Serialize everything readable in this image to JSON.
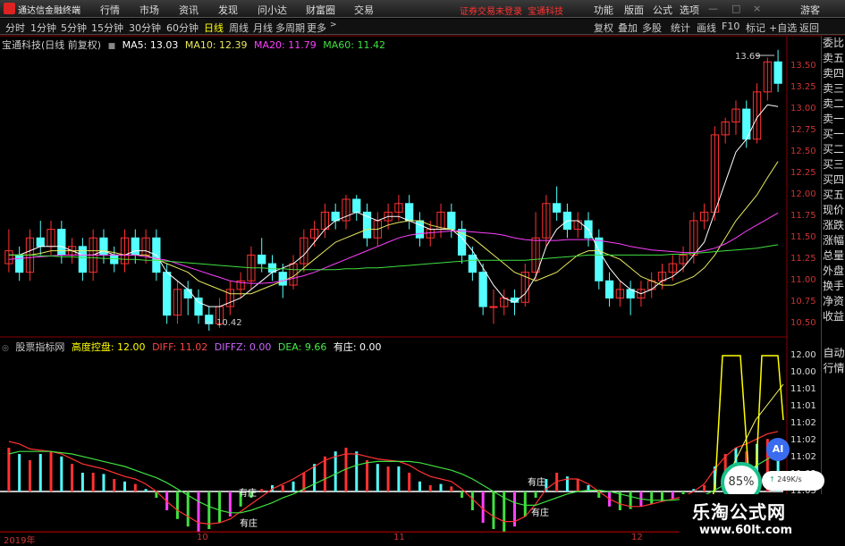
{
  "menubar": {
    "app_title": "通达信金融终端",
    "menus": [
      "行情",
      "市场",
      "资讯",
      "发现",
      "问小达",
      "财富圈",
      "交易"
    ],
    "notice": "证券交易未登录",
    "stock_name": "宝通科技",
    "right_menus": [
      "功能",
      "版面",
      "公式",
      "选项"
    ],
    "login": "游客"
  },
  "tabbar": {
    "tabs": [
      "分时",
      "1分钟",
      "5分钟",
      "15分钟",
      "30分钟",
      "60分钟",
      "日线",
      "周线",
      "月线",
      "多周期",
      "更多"
    ],
    "active_tab": "日线",
    "right_buttons": [
      "复权",
      "叠加",
      "多股",
      "统计",
      "画线",
      "F10",
      "标记",
      "+自选",
      "返回"
    ]
  },
  "kline_info": {
    "title": "宝通科技(日线 前复权)",
    "ma5": "MA5: 13.03",
    "ma10": "MA10: 12.39",
    "ma20": "MA20: 11.79",
    "ma60": "MA60: 11.42"
  },
  "sub_info": {
    "title": "股票指标网",
    "gkkp": "高度控盘: 12.00",
    "diff": "DIFF: 11.02",
    "diffz": "DIFFZ: 0.00",
    "dea": "DEA: 9.66",
    "youzhuang": "有庄: 0.00"
  },
  "price_axis": [
    "13.50",
    "13.25",
    "13.00",
    "12.75",
    "12.50",
    "12.25",
    "12.00",
    "11.75",
    "11.50",
    "11.25",
    "11.00",
    "10.75",
    "10.50"
  ],
  "sub_axis": [
    "12.00",
    "10.00",
    "11:01",
    "11:01",
    "11:02",
    "11:02",
    "11:02",
    "11:02",
    "11:03"
  ],
  "dates": [
    "2019年",
    "10",
    "11",
    "12"
  ],
  "annotations": {
    "high": "13.69",
    "low": "10.42",
    "zhuang_labels": [
      "有庄",
      "有庄",
      "有庄",
      "有庄"
    ]
  },
  "right_panel": {
    "items": [
      "委比",
      "卖五",
      "卖四",
      "卖三",
      "卖二",
      "卖一",
      "买一",
      "买二",
      "买三",
      "买四",
      "买五",
      "现价",
      "涨跌",
      "涨幅",
      "总量",
      "外盘",
      "换手",
      "净资",
      "收益"
    ],
    "items2": [
      "自动",
      "行情"
    ]
  },
  "widgets": {
    "ai": "AI",
    "speed": "85%",
    "net": "249K/s"
  },
  "watermark": {
    "line1": "乐淘公式网",
    "line2": "www.60lt.com"
  },
  "colors": {
    "up": "#ff3232",
    "down": "#54ffff",
    "ma5": "#ffffff",
    "ma10": "#e8e860",
    "ma20": "#ff40ff",
    "ma60": "#40e040",
    "accent": "#ffff00"
  },
  "chart_data": {
    "type": "candlestick",
    "ylim": [
      10.4,
      13.7
    ],
    "candles": [
      [
        11.2,
        11.35,
        11.1,
        11.6
      ],
      [
        11.3,
        11.1,
        11.0,
        11.4
      ],
      [
        11.1,
        11.5,
        11.0,
        11.6
      ],
      [
        11.5,
        11.4,
        11.3,
        11.7
      ],
      [
        11.4,
        11.6,
        11.3,
        11.7
      ],
      [
        11.6,
        11.3,
        11.2,
        11.7
      ],
      [
        11.3,
        11.4,
        11.2,
        11.5
      ],
      [
        11.4,
        11.1,
        11.0,
        11.5
      ],
      [
        11.1,
        11.5,
        11.0,
        11.6
      ],
      [
        11.5,
        11.3,
        11.2,
        11.6
      ],
      [
        11.3,
        11.2,
        11.1,
        11.4
      ],
      [
        11.2,
        11.5,
        11.1,
        11.6
      ],
      [
        11.5,
        11.3,
        11.2,
        11.6
      ],
      [
        11.3,
        11.5,
        11.2,
        11.6
      ],
      [
        11.5,
        11.1,
        11.0,
        11.6
      ],
      [
        11.1,
        10.6,
        10.5,
        11.2
      ],
      [
        10.6,
        10.9,
        10.5,
        11.0
      ],
      [
        10.9,
        10.8,
        10.6,
        11.0
      ],
      [
        10.8,
        10.6,
        10.5,
        10.9
      ],
      [
        10.6,
        10.5,
        10.42,
        10.7
      ],
      [
        10.5,
        10.7,
        10.45,
        10.8
      ],
      [
        10.7,
        10.9,
        10.6,
        11.0
      ],
      [
        10.9,
        11.0,
        10.8,
        11.1
      ],
      [
        11.0,
        11.3,
        10.9,
        11.4
      ],
      [
        11.3,
        11.2,
        11.1,
        11.5
      ],
      [
        11.2,
        11.1,
        11.0,
        11.3
      ],
      [
        11.1,
        10.95,
        10.8,
        11.2
      ],
      [
        10.95,
        11.2,
        10.9,
        11.3
      ],
      [
        11.2,
        11.5,
        11.1,
        11.6
      ],
      [
        11.5,
        11.6,
        11.4,
        11.7
      ],
      [
        11.6,
        11.8,
        11.5,
        11.9
      ],
      [
        11.8,
        11.7,
        11.6,
        11.9
      ],
      [
        11.7,
        11.95,
        11.6,
        12.0
      ],
      [
        11.95,
        11.8,
        11.7,
        12.0
      ],
      [
        11.8,
        11.5,
        11.4,
        11.9
      ],
      [
        11.5,
        11.7,
        11.4,
        11.8
      ],
      [
        11.7,
        11.8,
        11.6,
        11.9
      ],
      [
        11.8,
        11.9,
        11.7,
        12.0
      ],
      [
        11.9,
        11.7,
        11.6,
        12.0
      ],
      [
        11.7,
        11.5,
        11.4,
        11.8
      ],
      [
        11.5,
        11.6,
        11.4,
        11.7
      ],
      [
        11.6,
        11.8,
        11.5,
        11.9
      ],
      [
        11.8,
        11.6,
        11.5,
        11.9
      ],
      [
        11.6,
        11.3,
        11.2,
        11.7
      ],
      [
        11.3,
        11.1,
        11.0,
        11.4
      ],
      [
        11.1,
        10.7,
        10.6,
        11.2
      ],
      [
        10.7,
        10.7,
        10.5,
        10.9
      ],
      [
        10.7,
        10.8,
        10.6,
        10.9
      ],
      [
        10.8,
        10.75,
        10.6,
        10.9
      ],
      [
        10.75,
        11.1,
        10.7,
        11.2
      ],
      [
        11.1,
        11.5,
        11.0,
        11.8
      ],
      [
        11.5,
        11.9,
        11.4,
        12.0
      ],
      [
        11.9,
        11.8,
        11.7,
        12.1
      ],
      [
        11.8,
        11.6,
        11.5,
        11.9
      ],
      [
        11.6,
        11.7,
        11.5,
        11.8
      ],
      [
        11.7,
        11.5,
        11.4,
        11.8
      ],
      [
        11.5,
        11.0,
        10.9,
        11.6
      ],
      [
        11.0,
        10.8,
        10.7,
        11.1
      ],
      [
        10.8,
        10.9,
        10.7,
        11.0
      ],
      [
        10.9,
        10.8,
        10.6,
        11.0
      ],
      [
        10.8,
        10.9,
        10.7,
        11.0
      ],
      [
        10.9,
        11.0,
        10.8,
        11.1
      ],
      [
        11.0,
        11.1,
        10.9,
        11.2
      ],
      [
        11.1,
        11.2,
        11.0,
        11.3
      ],
      [
        11.2,
        11.3,
        11.1,
        11.4
      ],
      [
        11.3,
        11.7,
        11.2,
        11.8
      ],
      [
        11.7,
        11.8,
        11.6,
        11.9
      ],
      [
        11.8,
        12.7,
        11.7,
        12.8
      ],
      [
        12.7,
        12.85,
        12.6,
        12.9
      ],
      [
        12.85,
        13.0,
        12.7,
        13.1
      ],
      [
        13.0,
        12.65,
        12.55,
        13.1
      ],
      [
        12.65,
        13.2,
        12.6,
        13.3
      ],
      [
        13.2,
        13.55,
        13.1,
        13.6
      ],
      [
        13.55,
        13.3,
        13.2,
        13.69
      ]
    ],
    "ma5": [
      11.3,
      11.3,
      11.35,
      11.4,
      11.4,
      11.4,
      11.35,
      11.3,
      11.3,
      11.35,
      11.3,
      11.3,
      11.35,
      11.35,
      11.3,
      11.1,
      11.0,
      10.9,
      10.75,
      10.7,
      10.7,
      10.75,
      10.8,
      10.9,
      11.0,
      11.1,
      11.15,
      11.2,
      11.3,
      11.45,
      11.6,
      11.7,
      11.75,
      11.8,
      11.75,
      11.7,
      11.75,
      11.75,
      11.7,
      11.65,
      11.6,
      11.6,
      11.6,
      11.5,
      11.35,
      11.15,
      10.95,
      10.8,
      10.75,
      10.85,
      11.05,
      11.4,
      11.6,
      11.7,
      11.7,
      11.6,
      11.35,
      11.15,
      11.0,
      10.9,
      10.85,
      10.9,
      11.0,
      11.05,
      11.15,
      11.3,
      11.45,
      11.8,
      12.15,
      12.5,
      12.65,
      12.9,
      13.05,
      13.03
    ],
    "ma10": [
      11.3,
      11.3,
      11.3,
      11.32,
      11.35,
      11.35,
      11.35,
      11.35,
      11.35,
      11.35,
      11.33,
      11.3,
      11.3,
      11.3,
      11.25,
      11.2,
      11.15,
      11.1,
      11.0,
      10.95,
      10.9,
      10.85,
      10.85,
      10.85,
      10.9,
      10.95,
      11.0,
      11.05,
      11.15,
      11.25,
      11.35,
      11.45,
      11.5,
      11.55,
      11.6,
      11.6,
      11.65,
      11.68,
      11.7,
      11.7,
      11.65,
      11.62,
      11.6,
      11.55,
      11.5,
      11.4,
      11.3,
      11.2,
      11.1,
      11.05,
      11.0,
      11.05,
      11.1,
      11.2,
      11.3,
      11.35,
      11.35,
      11.3,
      11.25,
      11.15,
      11.05,
      11.0,
      10.95,
      10.95,
      11.0,
      11.05,
      11.15,
      11.3,
      11.5,
      11.7,
      11.85,
      12.0,
      12.2,
      12.39
    ],
    "ma20": [
      11.25,
      11.26,
      11.27,
      11.28,
      11.29,
      11.3,
      11.3,
      11.3,
      11.3,
      11.3,
      11.3,
      11.3,
      11.3,
      11.28,
      11.26,
      11.24,
      11.2,
      11.16,
      11.12,
      11.08,
      11.04,
      11.0,
      10.98,
      10.97,
      10.97,
      10.98,
      11.0,
      11.03,
      11.06,
      11.1,
      11.15,
      11.2,
      11.25,
      11.3,
      11.35,
      11.4,
      11.45,
      11.5,
      11.53,
      11.55,
      11.56,
      11.57,
      11.58,
      11.58,
      11.57,
      11.56,
      11.55,
      11.53,
      11.5,
      11.48,
      11.47,
      11.47,
      11.47,
      11.48,
      11.48,
      11.48,
      11.47,
      11.45,
      11.43,
      11.4,
      11.38,
      11.36,
      11.35,
      11.34,
      11.33,
      11.33,
      11.35,
      11.38,
      11.43,
      11.5,
      11.58,
      11.65,
      11.72,
      11.79
    ],
    "ma60": [
      11.3,
      11.3,
      11.3,
      11.29,
      11.29,
      11.28,
      11.28,
      11.27,
      11.27,
      11.26,
      11.26,
      11.25,
      11.25,
      11.24,
      11.24,
      11.23,
      11.22,
      11.21,
      11.2,
      11.19,
      11.18,
      11.17,
      11.16,
      11.15,
      11.15,
      11.14,
      11.14,
      11.13,
      11.13,
      11.13,
      11.13,
      11.13,
      11.14,
      11.14,
      11.15,
      11.15,
      11.16,
      11.17,
      11.18,
      11.19,
      11.2,
      11.21,
      11.22,
      11.23,
      11.24,
      11.24,
      11.24,
      11.24,
      11.24,
      11.24,
      11.25,
      11.26,
      11.27,
      11.28,
      11.29,
      11.3,
      11.3,
      11.3,
      11.3,
      11.3,
      11.3,
      11.3,
      11.3,
      11.31,
      11.31,
      11.32,
      11.33,
      11.34,
      11.35,
      11.36,
      11.37,
      11.38,
      11.4,
      11.42
    ],
    "macd": [
      0.35,
      0.3,
      0.25,
      0.3,
      0.32,
      0.28,
      0.22,
      0.15,
      0.15,
      0.14,
      0.1,
      0.08,
      0.06,
      0.02,
      -0.05,
      -0.15,
      -0.22,
      -0.28,
      -0.32,
      -0.3,
      -0.25,
      -0.2,
      -0.12,
      -0.05,
      0.02,
      0.05,
      0.05,
      0.08,
      0.15,
      0.22,
      0.28,
      0.32,
      0.35,
      0.32,
      0.25,
      0.22,
      0.2,
      0.2,
      0.15,
      0.08,
      0.05,
      0.06,
      0.04,
      -0.05,
      -0.15,
      -0.25,
      -0.3,
      -0.32,
      -0.28,
      -0.2,
      -0.05,
      0.1,
      0.15,
      0.12,
      0.1,
      0.05,
      -0.05,
      -0.12,
      -0.15,
      -0.14,
      -0.12,
      -0.1,
      -0.08,
      -0.06,
      -0.04,
      0.02,
      0.05,
      0.2,
      0.3,
      0.35,
      0.32,
      0.38,
      0.42,
      0.4
    ],
    "diff": [
      0.4,
      0.38,
      0.34,
      0.33,
      0.32,
      0.3,
      0.26,
      0.22,
      0.2,
      0.18,
      0.15,
      0.12,
      0.1,
      0.06,
      0.0,
      -0.08,
      -0.15,
      -0.2,
      -0.25,
      -0.26,
      -0.25,
      -0.22,
      -0.16,
      -0.1,
      -0.04,
      0.02,
      0.06,
      0.1,
      0.15,
      0.2,
      0.25,
      0.28,
      0.3,
      0.3,
      0.28,
      0.26,
      0.25,
      0.24,
      0.21,
      0.16,
      0.12,
      0.1,
      0.08,
      0.02,
      -0.06,
      -0.14,
      -0.2,
      -0.24,
      -0.24,
      -0.2,
      -0.1,
      0.02,
      0.08,
      0.1,
      0.1,
      0.06,
      0.0,
      -0.06,
      -0.1,
      -0.12,
      -0.12,
      -0.1,
      -0.08,
      -0.06,
      -0.04,
      0.0,
      0.06,
      0.18,
      0.28,
      0.35,
      0.38,
      0.42,
      0.46,
      0.48
    ],
    "dea": [
      0.3,
      0.32,
      0.32,
      0.32,
      0.32,
      0.31,
      0.3,
      0.28,
      0.26,
      0.24,
      0.22,
      0.2,
      0.17,
      0.14,
      0.11,
      0.07,
      0.02,
      -0.03,
      -0.08,
      -0.12,
      -0.15,
      -0.17,
      -0.17,
      -0.15,
      -0.12,
      -0.09,
      -0.05,
      -0.02,
      0.02,
      0.06,
      0.1,
      0.14,
      0.18,
      0.21,
      0.23,
      0.24,
      0.24,
      0.24,
      0.24,
      0.23,
      0.21,
      0.19,
      0.17,
      0.14,
      0.1,
      0.05,
      0.0,
      -0.05,
      -0.09,
      -0.11,
      -0.11,
      -0.08,
      -0.05,
      -0.02,
      0.0,
      0.01,
      0.01,
      0.0,
      -0.02,
      -0.04,
      -0.06,
      -0.07,
      -0.07,
      -0.07,
      -0.06,
      -0.05,
      -0.03,
      0.01,
      0.06,
      0.11,
      0.16,
      0.21,
      0.26,
      0.3
    ]
  }
}
